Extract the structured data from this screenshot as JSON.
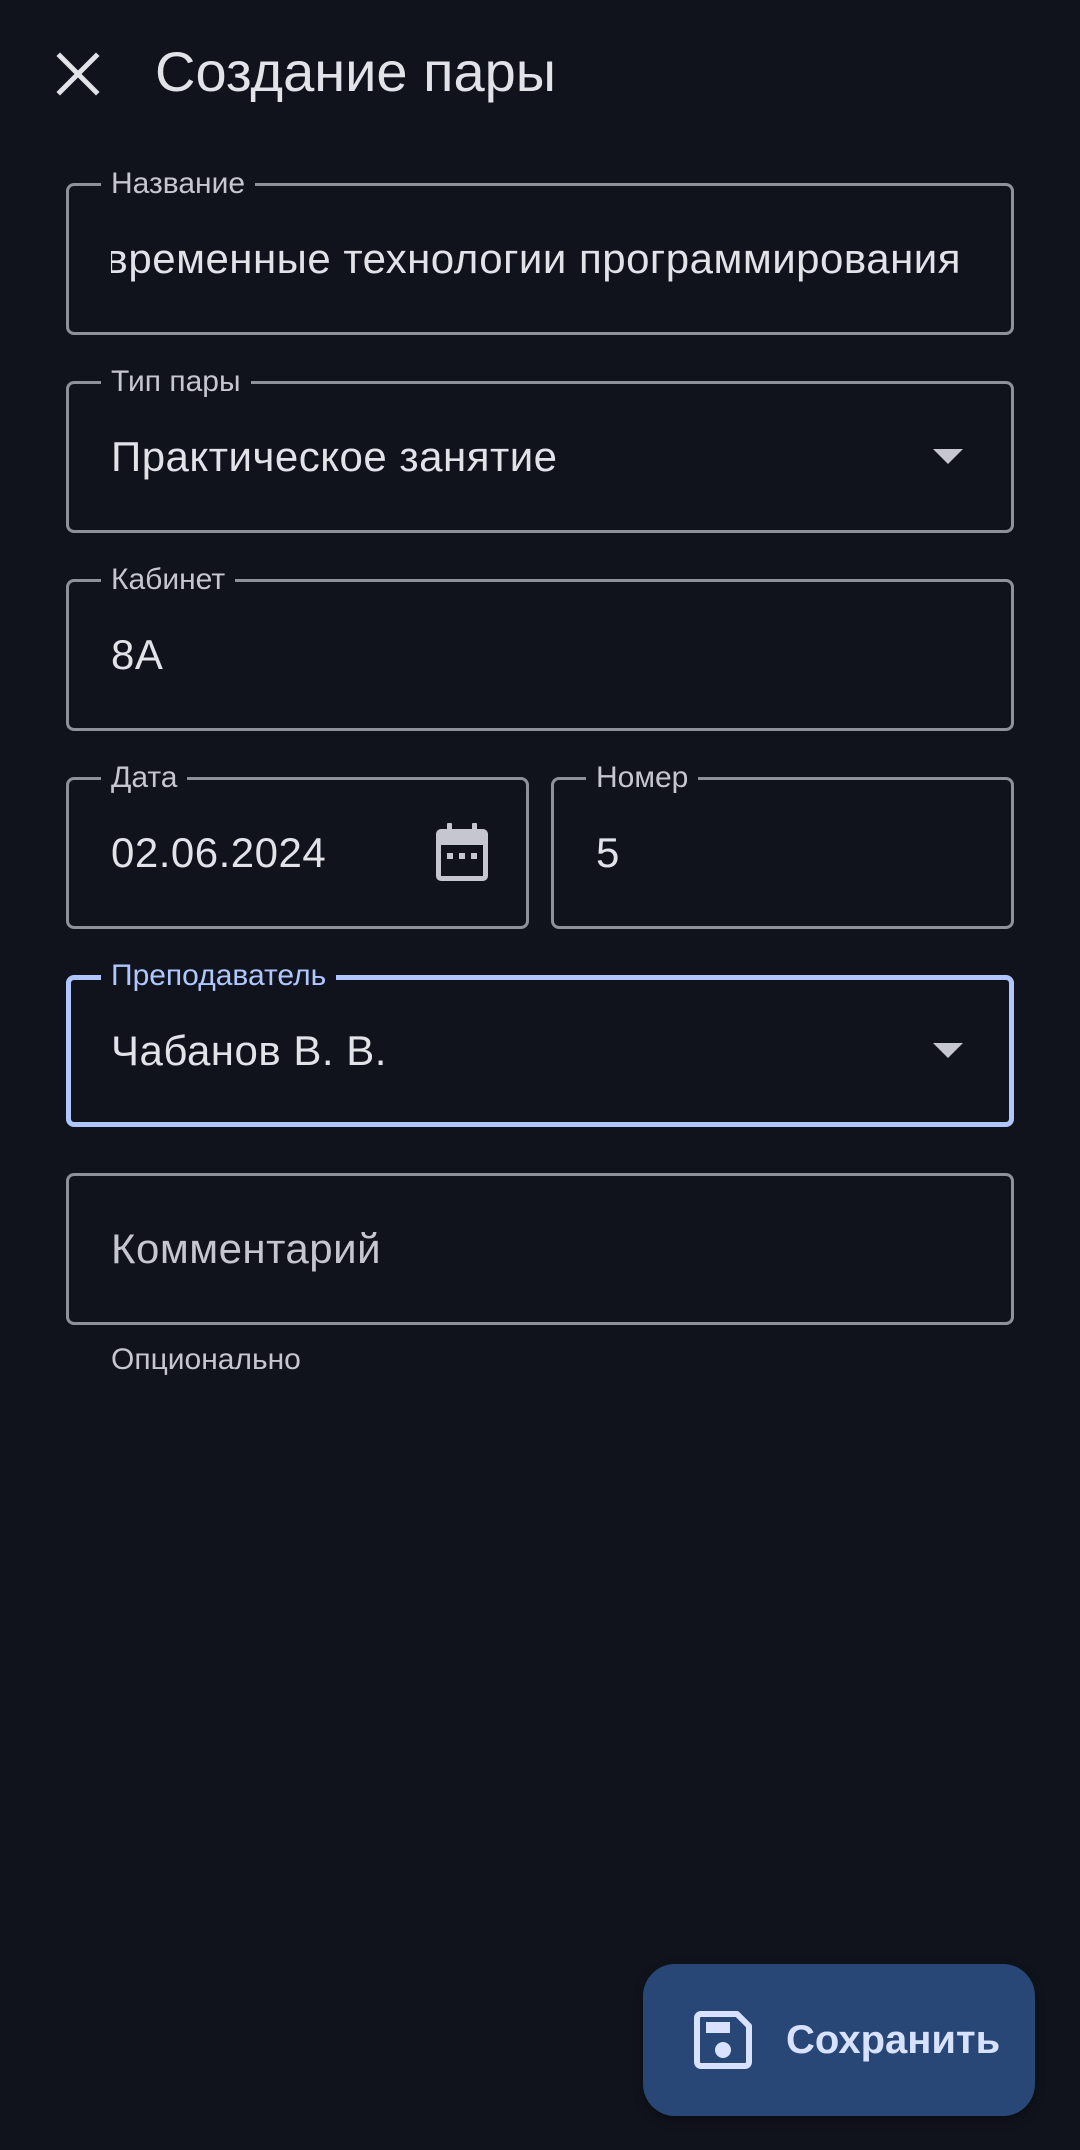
{
  "header": {
    "title": "Создание пары",
    "close_icon": "close-icon"
  },
  "form": {
    "name": {
      "label": "Название",
      "value": "Современные технологии программирования"
    },
    "pair_type": {
      "label": "Тип пары",
      "value": "Практическое занятие"
    },
    "room": {
      "label": "Кабинет",
      "value": "8А"
    },
    "date": {
      "label": "Дата",
      "value": "02.06.2024",
      "icon": "calendar-icon"
    },
    "number": {
      "label": "Номер",
      "value": "5"
    },
    "teacher": {
      "label": "Преподаватель",
      "value": "Чабанов В. В."
    },
    "comment": {
      "placeholder": "Комментарий",
      "supporting_text": "Опционально"
    }
  },
  "actions": {
    "save_label": "Сохранить",
    "save_icon": "save-icon"
  },
  "colors": {
    "background": "#11131c",
    "outline": "#8e909a",
    "focus": "#b0c6ff",
    "fab_background": "#284777",
    "fab_content": "#d8e2ff"
  }
}
